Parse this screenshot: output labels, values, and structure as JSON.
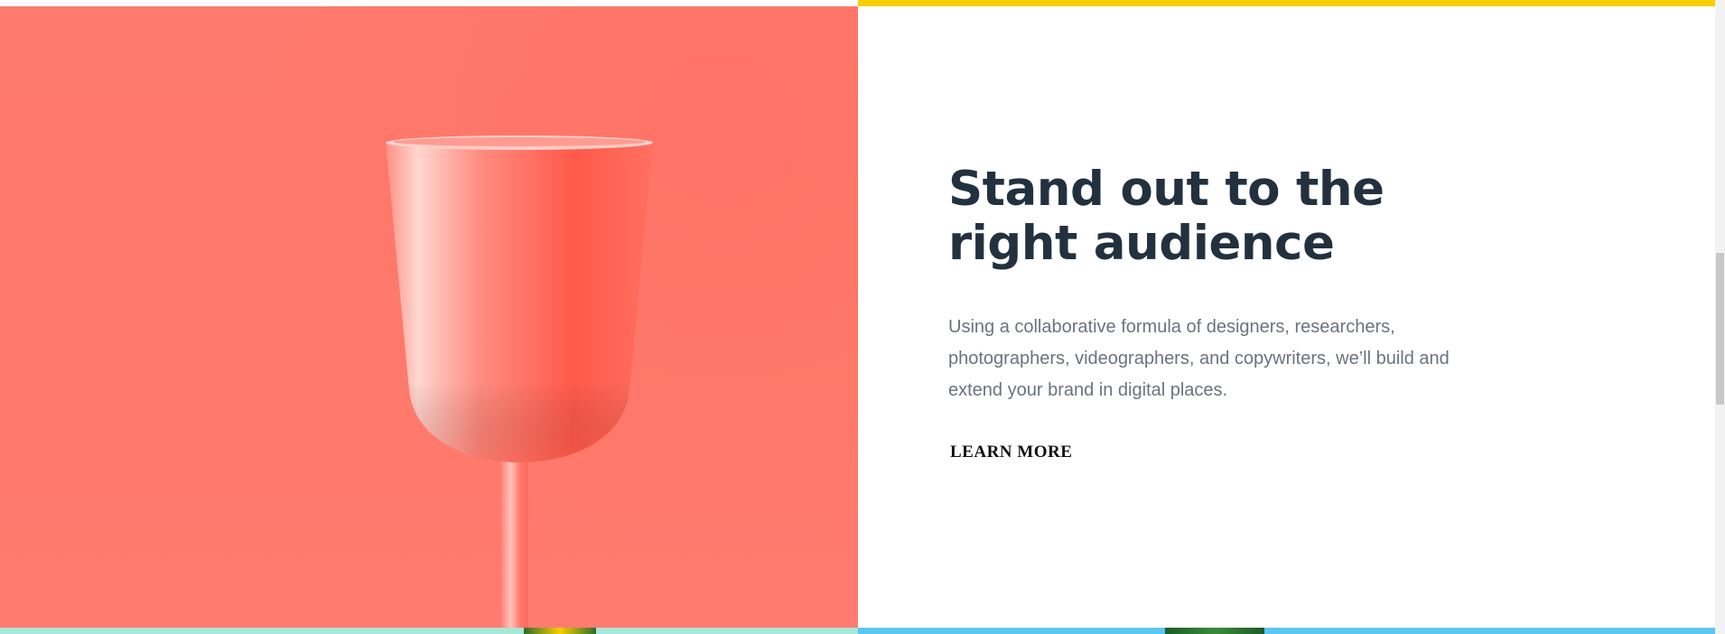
{
  "section": {
    "headline_line1": "Stand out to the",
    "headline_line2": "right audience",
    "body": "Using a collaborative formula of designers, researchers, photographers, videographers, and copywriters, we’ll build and extend your brand in digital places.",
    "cta_label": "LEARN MORE"
  },
  "image": {
    "icon": "wine-glass-image",
    "background_color": "#ff7a6b"
  },
  "colors": {
    "top_accent": "#f7cf06",
    "headline": "#23313f",
    "body_text": "#6b7280",
    "cta_underline": "#f9c6c1",
    "bottom_left_accent": "#a8e6d6",
    "bottom_right_accent": "#5bc7f0"
  }
}
